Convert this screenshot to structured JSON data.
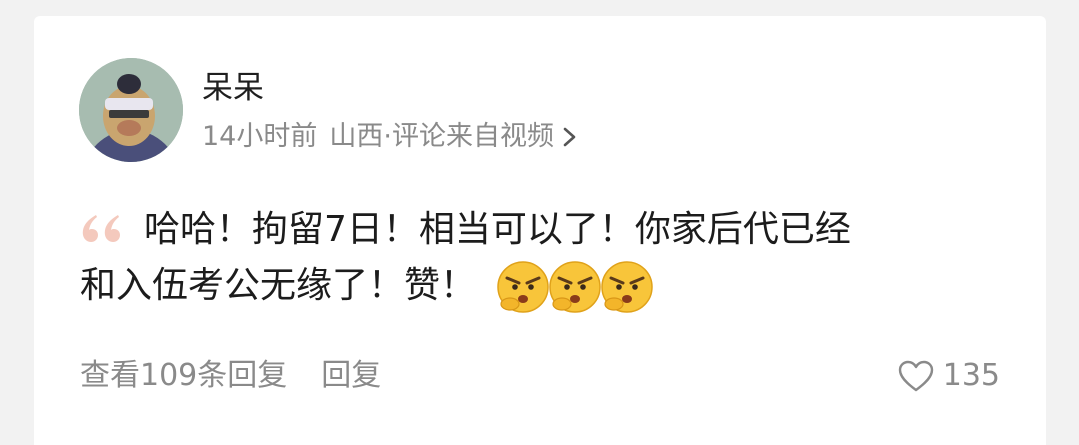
{
  "comment": {
    "user": {
      "name": "呆呆",
      "avatar_icon": "cartoon-character-avatar"
    },
    "meta": {
      "time": "14小时前",
      "location": "山西",
      "source": "·评论来自视频",
      "link_icon": "chevron-right-icon"
    },
    "text_line1": "哈哈！拘留7日！相当可以了！你家后代已经",
    "text_line2": "和入伍考公无缘了！赞！",
    "emojis": [
      "angry-thinking-emoji",
      "angry-thinking-emoji",
      "angry-thinking-emoji"
    ]
  },
  "footer": {
    "view_replies": "查看109条回复",
    "reply": "回复",
    "like_count": "135",
    "like_icon": "heart-icon"
  },
  "colors": {
    "background": "#f2f2f2",
    "card": "#ffffff",
    "text_primary": "#1c1c1c",
    "text_secondary": "#8a8a8a",
    "quote_accent": "#f4c9bd"
  }
}
